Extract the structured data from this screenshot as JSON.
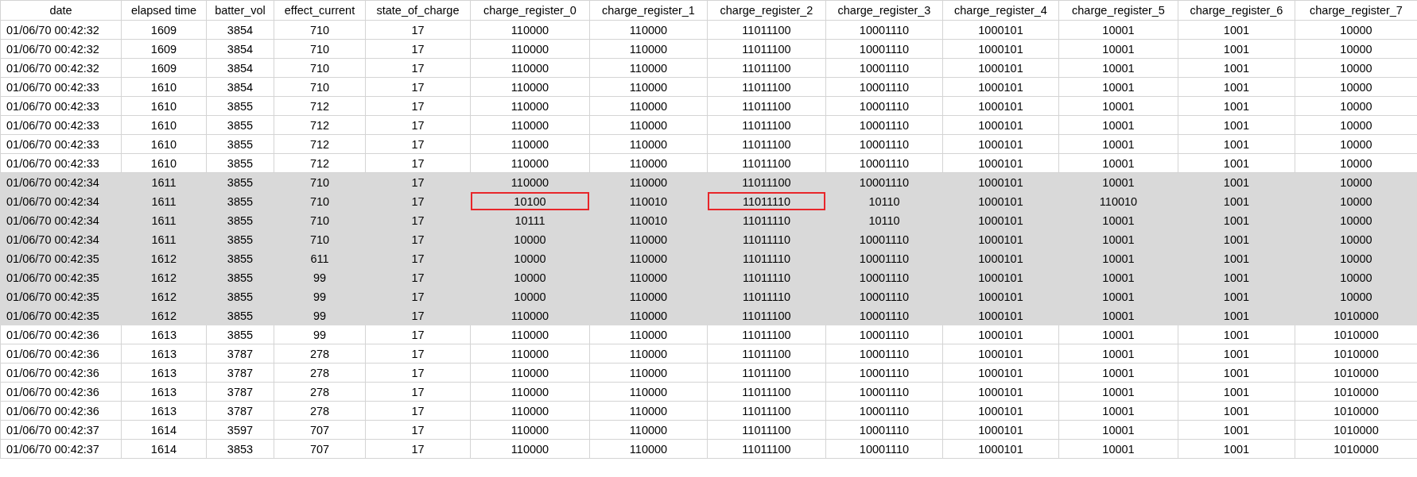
{
  "table": {
    "columns": [
      "date",
      "elapsed time",
      "batter_vol",
      "effect_current",
      "state_of_charge",
      "charge_register_0",
      "charge_register_1",
      "charge_register_2",
      "charge_register_3",
      "charge_register_4",
      "charge_register_5",
      "charge_register_6",
      "charge_register_7"
    ],
    "rows": [
      {
        "selected": false,
        "cells": [
          "01/06/70 00:42:32",
          "1609",
          "3854",
          "710",
          "17",
          "110000",
          "110000",
          "11011100",
          "10001110",
          "1000101",
          "10001",
          "1001",
          "10000"
        ],
        "outlined": [
          false,
          false,
          false,
          false,
          false,
          false,
          false,
          false,
          false,
          false,
          false,
          false,
          false
        ]
      },
      {
        "selected": false,
        "cells": [
          "01/06/70 00:42:32",
          "1609",
          "3854",
          "710",
          "17",
          "110000",
          "110000",
          "11011100",
          "10001110",
          "1000101",
          "10001",
          "1001",
          "10000"
        ],
        "outlined": [
          false,
          false,
          false,
          false,
          false,
          false,
          false,
          false,
          false,
          false,
          false,
          false,
          false
        ]
      },
      {
        "selected": false,
        "cells": [
          "01/06/70 00:42:32",
          "1609",
          "3854",
          "710",
          "17",
          "110000",
          "110000",
          "11011100",
          "10001110",
          "1000101",
          "10001",
          "1001",
          "10000"
        ],
        "outlined": [
          false,
          false,
          false,
          false,
          false,
          false,
          false,
          false,
          false,
          false,
          false,
          false,
          false
        ]
      },
      {
        "selected": false,
        "cells": [
          "01/06/70 00:42:33",
          "1610",
          "3854",
          "710",
          "17",
          "110000",
          "110000",
          "11011100",
          "10001110",
          "1000101",
          "10001",
          "1001",
          "10000"
        ],
        "outlined": [
          false,
          false,
          false,
          false,
          false,
          false,
          false,
          false,
          false,
          false,
          false,
          false,
          false
        ]
      },
      {
        "selected": false,
        "cells": [
          "01/06/70 00:42:33",
          "1610",
          "3855",
          "712",
          "17",
          "110000",
          "110000",
          "11011100",
          "10001110",
          "1000101",
          "10001",
          "1001",
          "10000"
        ],
        "outlined": [
          false,
          false,
          false,
          false,
          false,
          false,
          false,
          false,
          false,
          false,
          false,
          false,
          false
        ]
      },
      {
        "selected": false,
        "cells": [
          "01/06/70 00:42:33",
          "1610",
          "3855",
          "712",
          "17",
          "110000",
          "110000",
          "11011100",
          "10001110",
          "1000101",
          "10001",
          "1001",
          "10000"
        ],
        "outlined": [
          false,
          false,
          false,
          false,
          false,
          false,
          false,
          false,
          false,
          false,
          false,
          false,
          false
        ]
      },
      {
        "selected": false,
        "cells": [
          "01/06/70 00:42:33",
          "1610",
          "3855",
          "712",
          "17",
          "110000",
          "110000",
          "11011100",
          "10001110",
          "1000101",
          "10001",
          "1001",
          "10000"
        ],
        "outlined": [
          false,
          false,
          false,
          false,
          false,
          false,
          false,
          false,
          false,
          false,
          false,
          false,
          false
        ]
      },
      {
        "selected": false,
        "cells": [
          "01/06/70 00:42:33",
          "1610",
          "3855",
          "712",
          "17",
          "110000",
          "110000",
          "11011100",
          "10001110",
          "1000101",
          "10001",
          "1001",
          "10000"
        ],
        "outlined": [
          false,
          false,
          false,
          false,
          false,
          false,
          false,
          false,
          false,
          false,
          false,
          false,
          false
        ]
      },
      {
        "selected": true,
        "cells": [
          "01/06/70 00:42:34",
          "1611",
          "3855",
          "710",
          "17",
          "110000",
          "110000",
          "11011100",
          "10001110",
          "1000101",
          "10001",
          "1001",
          "10000"
        ],
        "outlined": [
          false,
          false,
          false,
          false,
          false,
          false,
          false,
          false,
          false,
          false,
          false,
          false,
          false
        ]
      },
      {
        "selected": true,
        "cells": [
          "01/06/70 00:42:34",
          "1611",
          "3855",
          "710",
          "17",
          "10100",
          "110010",
          "11011110",
          "10110",
          "1000101",
          "110010",
          "1001",
          "10000"
        ],
        "outlined": [
          false,
          false,
          false,
          false,
          false,
          true,
          false,
          true,
          false,
          false,
          false,
          false,
          false
        ]
      },
      {
        "selected": true,
        "cells": [
          "01/06/70 00:42:34",
          "1611",
          "3855",
          "710",
          "17",
          "10111",
          "110010",
          "11011110",
          "10110",
          "1000101",
          "10001",
          "1001",
          "10000"
        ],
        "outlined": [
          false,
          false,
          false,
          false,
          false,
          false,
          false,
          false,
          false,
          false,
          false,
          false,
          false
        ]
      },
      {
        "selected": true,
        "cells": [
          "01/06/70 00:42:34",
          "1611",
          "3855",
          "710",
          "17",
          "10000",
          "110000",
          "11011110",
          "10001110",
          "1000101",
          "10001",
          "1001",
          "10000"
        ],
        "outlined": [
          false,
          false,
          false,
          false,
          false,
          false,
          false,
          false,
          false,
          false,
          false,
          false,
          false
        ]
      },
      {
        "selected": true,
        "cells": [
          "01/06/70 00:42:35",
          "1612",
          "3855",
          "611",
          "17",
          "10000",
          "110000",
          "11011110",
          "10001110",
          "1000101",
          "10001",
          "1001",
          "10000"
        ],
        "outlined": [
          false,
          false,
          false,
          false,
          false,
          false,
          false,
          false,
          false,
          false,
          false,
          false,
          false
        ]
      },
      {
        "selected": true,
        "cells": [
          "01/06/70 00:42:35",
          "1612",
          "3855",
          "99",
          "17",
          "10000",
          "110000",
          "11011110",
          "10001110",
          "1000101",
          "10001",
          "1001",
          "10000"
        ],
        "outlined": [
          false,
          false,
          false,
          false,
          false,
          false,
          false,
          false,
          false,
          false,
          false,
          false,
          false
        ]
      },
      {
        "selected": true,
        "cells": [
          "01/06/70 00:42:35",
          "1612",
          "3855",
          "99",
          "17",
          "10000",
          "110000",
          "11011110",
          "10001110",
          "1000101",
          "10001",
          "1001",
          "10000"
        ],
        "outlined": [
          false,
          false,
          false,
          false,
          false,
          false,
          false,
          false,
          false,
          false,
          false,
          false,
          false
        ]
      },
      {
        "selected": true,
        "cells": [
          "01/06/70 00:42:35",
          "1612",
          "3855",
          "99",
          "17",
          "110000",
          "110000",
          "11011100",
          "10001110",
          "1000101",
          "10001",
          "1001",
          "1010000"
        ],
        "outlined": [
          false,
          false,
          false,
          false,
          false,
          false,
          false,
          false,
          false,
          false,
          false,
          false,
          false
        ]
      },
      {
        "selected": false,
        "cells": [
          "01/06/70 00:42:36",
          "1613",
          "3855",
          "99",
          "17",
          "110000",
          "110000",
          "11011100",
          "10001110",
          "1000101",
          "10001",
          "1001",
          "1010000"
        ],
        "outlined": [
          false,
          false,
          false,
          false,
          false,
          false,
          false,
          false,
          false,
          false,
          false,
          false,
          false
        ]
      },
      {
        "selected": false,
        "cells": [
          "01/06/70 00:42:36",
          "1613",
          "3787",
          "278",
          "17",
          "110000",
          "110000",
          "11011100",
          "10001110",
          "1000101",
          "10001",
          "1001",
          "1010000"
        ],
        "outlined": [
          false,
          false,
          false,
          false,
          false,
          false,
          false,
          false,
          false,
          false,
          false,
          false,
          false
        ]
      },
      {
        "selected": false,
        "cells": [
          "01/06/70 00:42:36",
          "1613",
          "3787",
          "278",
          "17",
          "110000",
          "110000",
          "11011100",
          "10001110",
          "1000101",
          "10001",
          "1001",
          "1010000"
        ],
        "outlined": [
          false,
          false,
          false,
          false,
          false,
          false,
          false,
          false,
          false,
          false,
          false,
          false,
          false
        ]
      },
      {
        "selected": false,
        "cells": [
          "01/06/70 00:42:36",
          "1613",
          "3787",
          "278",
          "17",
          "110000",
          "110000",
          "11011100",
          "10001110",
          "1000101",
          "10001",
          "1001",
          "1010000"
        ],
        "outlined": [
          false,
          false,
          false,
          false,
          false,
          false,
          false,
          false,
          false,
          false,
          false,
          false,
          false
        ]
      },
      {
        "selected": false,
        "cells": [
          "01/06/70 00:42:36",
          "1613",
          "3787",
          "278",
          "17",
          "110000",
          "110000",
          "11011100",
          "10001110",
          "1000101",
          "10001",
          "1001",
          "1010000"
        ],
        "outlined": [
          false,
          false,
          false,
          false,
          false,
          false,
          false,
          false,
          false,
          false,
          false,
          false,
          false
        ]
      },
      {
        "selected": false,
        "cells": [
          "01/06/70 00:42:37",
          "1614",
          "3597",
          "707",
          "17",
          "110000",
          "110000",
          "11011100",
          "10001110",
          "1000101",
          "10001",
          "1001",
          "1010000"
        ],
        "outlined": [
          false,
          false,
          false,
          false,
          false,
          false,
          false,
          false,
          false,
          false,
          false,
          false,
          false
        ]
      },
      {
        "selected": false,
        "cells": [
          "01/06/70 00:42:37",
          "1614",
          "3853",
          "707",
          "17",
          "110000",
          "110000",
          "11011100",
          "10001110",
          "1000101",
          "10001",
          "1001",
          "1010000"
        ],
        "outlined": [
          false,
          false,
          false,
          false,
          false,
          false,
          false,
          false,
          false,
          false,
          false,
          false,
          false
        ]
      }
    ]
  }
}
